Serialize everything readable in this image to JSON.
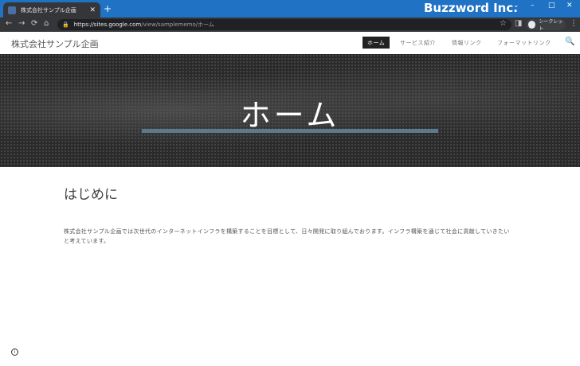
{
  "browser": {
    "tab_title": "株式会社サンプル企画",
    "brand": "Buzzword Inc.",
    "url_domain": "https://sites.google.com",
    "url_path": "/view/samplememo/ホーム",
    "profile_label": "シークレット"
  },
  "site": {
    "title": "株式会社サンプル企画",
    "nav": [
      "ホーム",
      "サービス紹介",
      "情報リンク",
      "フォーマットリンク"
    ]
  },
  "hero": {
    "heading": "ホーム"
  },
  "content": {
    "title": "はじめに",
    "body": "株式会社サンプル企画では次世代のインターネットインフラを構築することを目標として、日々開発に取り組んでおります。インフラ構築を通じて社会に貢献していきたいと考えています。"
  }
}
